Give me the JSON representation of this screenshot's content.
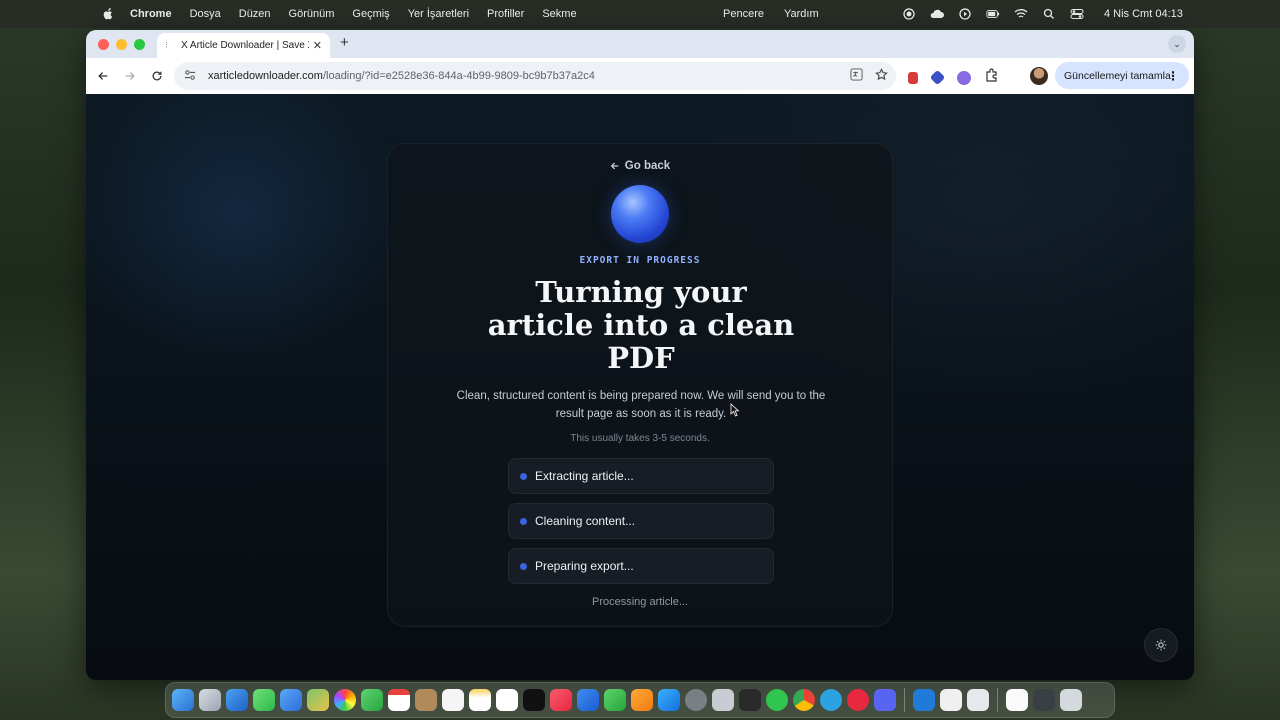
{
  "menubar": {
    "app_name": "Chrome",
    "menus": [
      "Dosya",
      "Düzen",
      "Görünüm",
      "Geçmiş",
      "Yer İşaretleri",
      "Profiller",
      "Sekme"
    ],
    "center_menus": [
      "Pencere",
      "Yardım"
    ],
    "datetime": "4 Nis Cmt  04:13"
  },
  "browser": {
    "tab_title": "X Article Downloader | Save X",
    "url_host": "xarticledownloader.com",
    "url_path": "/loading/?id=e2528e36-844a-4b99-9809-bc9b7b37a2c4",
    "update_button": "Güncellemeyi tamamla"
  },
  "page": {
    "go_back": "Go back",
    "status_label": "EXPORT IN PROGRESS",
    "headline": "Turning your article into a clean PDF",
    "subtitle": "Clean, structured content is being prepared now. We will send you to the result page as soon as it is ready.",
    "duration_note": "This usually takes 3-5 seconds.",
    "steps": [
      "Extracting article...",
      "Cleaning content...",
      "Preparing export..."
    ],
    "processing_text": "Processing article...",
    "accent_color": "#3b63e0"
  }
}
